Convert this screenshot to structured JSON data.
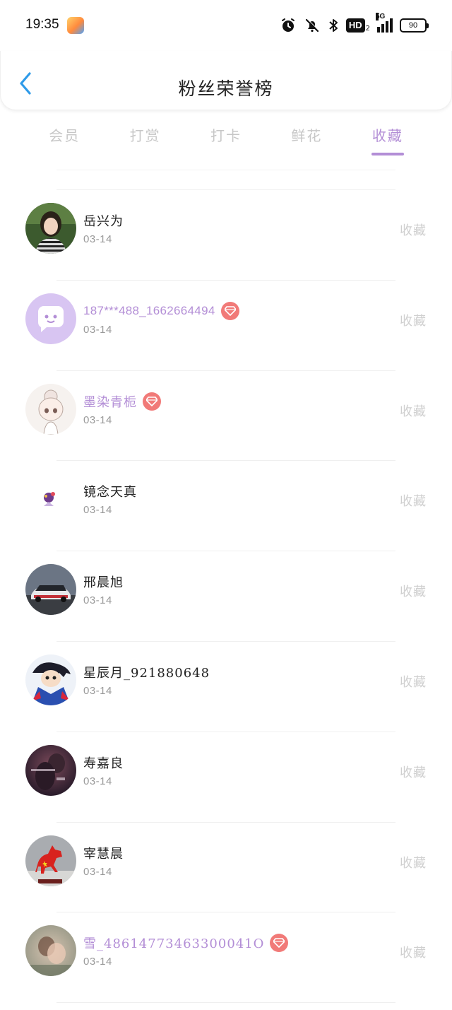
{
  "status_bar": {
    "time": "19:35",
    "battery": "90",
    "network": "5G",
    "hd_label": "HD",
    "hd_sub": "2"
  },
  "header": {
    "title": "粉丝荣誉榜"
  },
  "tabs": [
    {
      "label": "会员",
      "active": false
    },
    {
      "label": "打赏",
      "active": false
    },
    {
      "label": "打卡",
      "active": false
    },
    {
      "label": "鲜花",
      "active": false
    },
    {
      "label": "收藏",
      "active": true
    }
  ],
  "list": [
    {
      "name": "岳兴为",
      "date": "03-14",
      "action": "收藏",
      "vip": false,
      "avatar": "avatar-photo-woman"
    },
    {
      "name": "187***488_1662664494",
      "date": "03-14",
      "action": "收藏",
      "vip": true,
      "avatar": "avatar-chat-bubble"
    },
    {
      "name": "墨染青栀",
      "date": "03-14",
      "action": "收藏",
      "vip": true,
      "avatar": "avatar-sketch-girl"
    },
    {
      "name": "镜念天真",
      "date": "03-14",
      "action": "收藏",
      "vip": false,
      "avatar": "avatar-small-figure"
    },
    {
      "name": "邢晨旭",
      "date": "03-14",
      "action": "收藏",
      "vip": false,
      "avatar": "avatar-race-car"
    },
    {
      "name": "星辰月_921880648",
      "date": "03-14",
      "action": "收藏",
      "vip": false,
      "avatar": "avatar-anime-boy"
    },
    {
      "name": "寿嘉良",
      "date": "03-14",
      "action": "收藏",
      "vip": false,
      "avatar": "avatar-dark-couple"
    },
    {
      "name": "宰慧晨",
      "date": "03-14",
      "action": "收藏",
      "vip": false,
      "avatar": "avatar-red-horse"
    },
    {
      "name": "雪_48614773463300041O",
      "date": "03-14",
      "action": "收藏",
      "vip": true,
      "avatar": "avatar-blurred-photo"
    }
  ],
  "colors": {
    "accent": "#b38ed6",
    "badge": "#f17a78",
    "back_arrow": "#2f9be9",
    "muted": "#c7c7c7"
  }
}
